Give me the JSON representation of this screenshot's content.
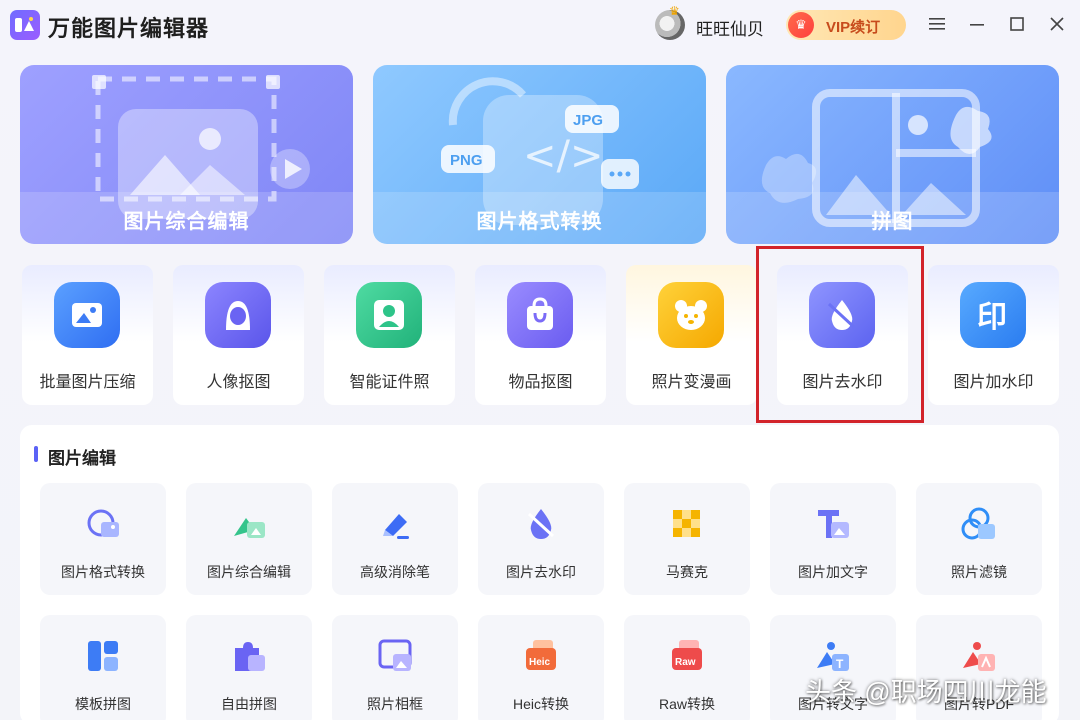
{
  "app": {
    "title": "万能图片编辑器"
  },
  "user": {
    "name": "旺旺仙贝",
    "vip_label": "VIP续订"
  },
  "big_cards": [
    {
      "label": "图片综合编辑"
    },
    {
      "label": "图片格式转换",
      "badges": [
        "PNG",
        "JPG"
      ]
    },
    {
      "label": "拼图"
    }
  ],
  "tools": [
    {
      "label": "批量图片压缩",
      "color": "#3d7cf5"
    },
    {
      "label": "人像抠图",
      "color": "#6a64f3"
    },
    {
      "label": "智能证件照",
      "color": "#2ec489"
    },
    {
      "label": "物品抠图",
      "color": "#7b6bf7"
    },
    {
      "label": "照片变漫画",
      "color": "#f5b400"
    },
    {
      "label": "图片去水印",
      "color": "#6b72f5"
    },
    {
      "label": "图片加水印",
      "color": "#2f8ef7",
      "glyph": "印"
    }
  ],
  "section": {
    "title": "图片编辑",
    "items": [
      {
        "label": "图片格式转换"
      },
      {
        "label": "图片综合编辑"
      },
      {
        "label": "高级消除笔"
      },
      {
        "label": "图片去水印"
      },
      {
        "label": "马赛克"
      },
      {
        "label": "图片加文字"
      },
      {
        "label": "照片滤镜"
      },
      {
        "label": "模板拼图"
      },
      {
        "label": "自由拼图"
      },
      {
        "label": "照片相框"
      },
      {
        "label": "Heic转换",
        "badge": "Heic"
      },
      {
        "label": "Raw转换",
        "badge": "Raw"
      },
      {
        "label": "图片转文字"
      },
      {
        "label": "图片转PDF"
      }
    ]
  },
  "watermark": "头条 @职场四川龙能",
  "colors": {
    "accent": "#5b62f6",
    "highlight": "#d2232a",
    "vip_text": "#c74b1c"
  }
}
